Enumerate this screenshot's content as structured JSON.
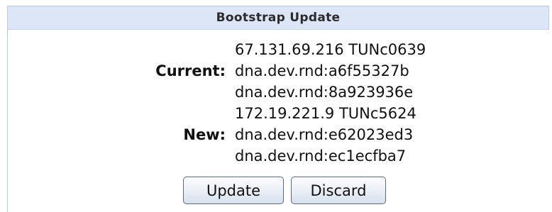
{
  "panel": {
    "title": "Bootstrap Update"
  },
  "current": {
    "label": "Current:",
    "lines": [
      "67.131.69.216 TUNc0639",
      "dna.dev.rnd:a6f55327b",
      "dna.dev.rnd:8a923936e"
    ]
  },
  "new": {
    "label": "New:",
    "lines": [
      "172.19.221.9 TUNc5624",
      "dna.dev.rnd:e62023ed3",
      "dna.dev.rnd:ec1ecfba7"
    ]
  },
  "actions": {
    "update_label": "Update",
    "discard_label": "Discard"
  },
  "colors": {
    "header_bg": "#dde6f6",
    "border": "#b9c9e8",
    "button_border": "#5c6a80"
  }
}
